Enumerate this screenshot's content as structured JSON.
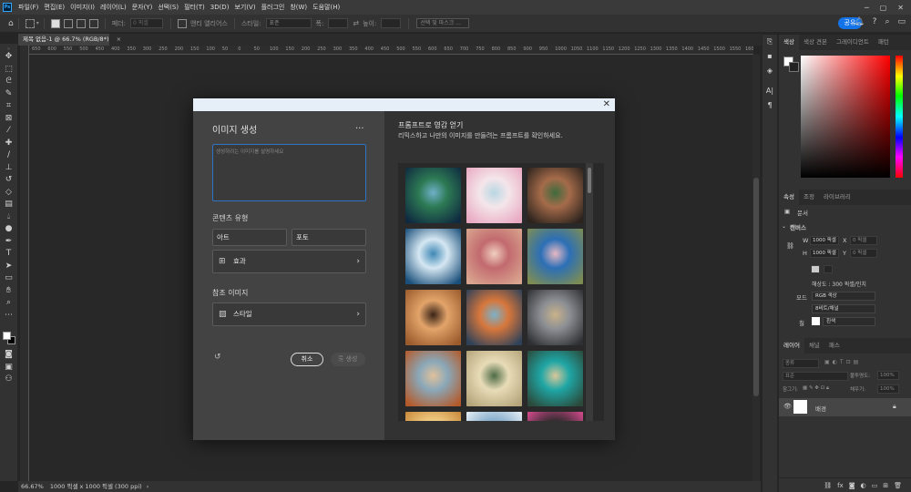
{
  "menubar": {
    "items": [
      "파일(F)",
      "편집(E)",
      "이미지(I)",
      "레이어(L)",
      "문자(Y)",
      "선택(S)",
      "필터(T)",
      "3D(D)",
      "보기(V)",
      "플러그인",
      "창(W)",
      "도움말(H)"
    ]
  },
  "optionsbar": {
    "feather_label": "페더:",
    "feather_value": "0 픽셀",
    "antialias_label": "앤티 앨리어스",
    "style_label": "스타일:",
    "style_value": "표준",
    "width_label": "폭:",
    "height_label": "높이:",
    "select_mask_label": "선택 및 마스크 ...",
    "share_label": "공유"
  },
  "document": {
    "tab_title": "제목 없음-1 @ 66.7% (RGB/8*)",
    "ruler_ticks": [
      "650",
      "600",
      "550",
      "500",
      "450",
      "400",
      "350",
      "300",
      "250",
      "200",
      "150",
      "100",
      "50",
      "0",
      "50",
      "100",
      "150",
      "200",
      "250",
      "300",
      "350",
      "400",
      "450",
      "500",
      "550",
      "600",
      "650",
      "700",
      "750",
      "800",
      "850",
      "900",
      "950",
      "1000",
      "1050",
      "1100",
      "1150",
      "1200",
      "1250",
      "1300",
      "1350",
      "1400",
      "1450",
      "1500",
      "1550",
      "1600"
    ],
    "zoom": "66.67%",
    "doc_info": "1000 픽셀 x 1000 픽셀 (300 ppi)"
  },
  "toolbar": {
    "tools": [
      "move-tool",
      "marquee-tool",
      "lasso-tool",
      "quick-select-tool",
      "crop-tool",
      "frame-tool",
      "eyedropper-tool",
      "spot-heal-tool",
      "brush-tool",
      "clone-stamp-tool",
      "history-brush-tool",
      "eraser-tool",
      "gradient-tool",
      "blur-tool",
      "dodge-tool",
      "pen-tool",
      "type-tool",
      "path-select-tool",
      "rectangle-tool",
      "hand-tool",
      "zoom-tool",
      "more-tools"
    ]
  },
  "color_panel": {
    "tabs": [
      "색상",
      "색상 견본",
      "그레이디언트",
      "패턴"
    ]
  },
  "properties_panel": {
    "tabs": [
      "속성",
      "조정",
      "라이브러리"
    ],
    "doc_label": "문서",
    "canvas_section": "캔버스",
    "w_label": "W",
    "w_value": "1000 픽셀",
    "h_label": "H",
    "h_value": "1000 픽셀",
    "x_label": "X",
    "x_placeholder": "0 픽셀",
    "y_label": "Y",
    "y_placeholder": "0 픽셀",
    "resolution": "해상도 : 300 픽셀/인치",
    "mode_label": "모드",
    "mode_value": "RGB 색상",
    "bit_value": "8비트/채널",
    "fill_label": "칠",
    "fill_value": "흰색"
  },
  "layers_panel": {
    "tabs": [
      "레이어",
      "채널",
      "패스"
    ],
    "filter_placeholder": "종류",
    "blend_value": "표준",
    "opacity_label": "불투명도:",
    "opacity_value": "100%",
    "lock_label": "잠그기:",
    "fill_label": "채우기:",
    "fill_value": "100%",
    "layer_name": "배경"
  },
  "modal": {
    "title": "이미지 생성",
    "prompt_placeholder": "생성하려는 이미지를 설명하세요",
    "content_type_label": "콘텐츠 유형",
    "art_label": "아트",
    "photo_label": "포토",
    "effects_label": "효과",
    "reference_label": "참조 이미지",
    "style_label": "스타일",
    "cancel_label": "취소",
    "generate_label": "생성",
    "inspiration_title": "프롬프트로 영감 얻기",
    "inspiration_subtitle": "리믹스하고 나만의 이미지를 만들려는 프롬프트를 확인하세요."
  },
  "gallery": {
    "items": [
      {
        "name": "castle-night-island",
        "colors": [
          "#0f2a40",
          "#2d7a54",
          "#6fb0c9"
        ]
      },
      {
        "name": "cherry-blossom-room",
        "colors": [
          "#e9a9c1",
          "#f4e6ea",
          "#b9d7e3"
        ]
      },
      {
        "name": "cartoon-girl-headphones",
        "colors": [
          "#2c231d",
          "#a56b4a",
          "#3e6b3d"
        ]
      },
      {
        "name": "ocean-wave",
        "colors": [
          "#1a4f7a",
          "#d5e7f2",
          "#3f87b5"
        ]
      },
      {
        "name": "pink-vase-still-life",
        "colors": [
          "#d9a58e",
          "#c26a6f",
          "#f0cfc0"
        ]
      },
      {
        "name": "blue-bird-flowers",
        "colors": [
          "#7d8c53",
          "#2c6fb6",
          "#e7b9c4"
        ]
      },
      {
        "name": "copper-vases",
        "colors": [
          "#9b5a2c",
          "#e3a46a",
          "#3a2417"
        ]
      },
      {
        "name": "colorful-bird-nest",
        "colors": [
          "#2e4159",
          "#d7773c",
          "#7bb1c8"
        ]
      },
      {
        "name": "storm-pedestal",
        "colors": [
          "#2f3033",
          "#8c8f94",
          "#c9b28a"
        ]
      },
      {
        "name": "koala-jacket",
        "colors": [
          "#b45a2a",
          "#8aa8b9",
          "#e0c09b"
        ]
      },
      {
        "name": "green-vase-room",
        "colors": [
          "#b5a57a",
          "#e8dcb8",
          "#4d6b45"
        ]
      },
      {
        "name": "tiny-house-island",
        "colors": [
          "#2b4a3b",
          "#1fa6a5",
          "#d9c79a"
        ]
      },
      {
        "name": "partial-row-1",
        "colors": [
          "#c8883a",
          "#f2d087",
          "#3a2a1c"
        ]
      },
      {
        "name": "partial-row-2",
        "colors": [
          "#e7eff5",
          "#7fa8c9",
          "#c9d9e6"
        ]
      },
      {
        "name": "partial-row-3",
        "colors": [
          "#d84a8f",
          "#2a2a2a",
          "#6fc2b1"
        ]
      }
    ]
  },
  "colors": {
    "accent": "#1473e6",
    "focus": "#2f74c4"
  }
}
